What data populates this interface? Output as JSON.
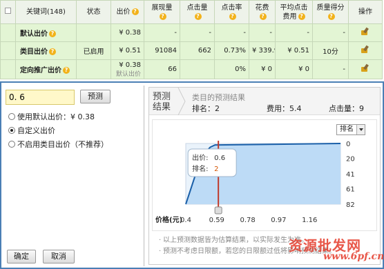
{
  "table": {
    "headers": {
      "keyword": "关键词(148)",
      "status": "状态",
      "bid": "出价",
      "impressions": "展现量",
      "clicks": "点击量",
      "ctr": "点击率",
      "cost": "花费",
      "avg_cpc_1": "平均点击",
      "avg_cpc_2": "费用",
      "quality": "质量得分",
      "actions": "操作"
    },
    "rows": [
      {
        "keyword": "默认出价",
        "status": "",
        "bid": "¥ 0.38",
        "bid_sub": "",
        "impressions": "-",
        "clicks": "-",
        "ctr": "-",
        "cost": "-",
        "cpc": "-",
        "quality": "-"
      },
      {
        "keyword": "类目出价",
        "status": "已启用",
        "bid": "¥ 0.51",
        "bid_sub": "",
        "impressions": "91084",
        "clicks": "662",
        "ctr": "0.73%",
        "cost": "¥ 339.9",
        "cpc": "¥ 0.51",
        "quality": "10分"
      },
      {
        "keyword": "定向推广出价",
        "status": "",
        "bid": "¥ 0.38",
        "bid_sub": "默认出价",
        "impressions": "66",
        "clicks": "",
        "ctr": "0%",
        "cost": "¥ 0",
        "cpc": "¥ 0",
        "quality": "-"
      }
    ]
  },
  "bid_panel": {
    "input_value": "0. 6",
    "predict_label": "预测",
    "options": [
      {
        "label": "使用默认出价：¥ 0.38",
        "selected": false
      },
      {
        "label": "自定义出价",
        "selected": true
      },
      {
        "label": "不启用类目出价（不推荐）",
        "selected": false
      }
    ],
    "confirm_label": "确定",
    "cancel_label": "取消"
  },
  "result": {
    "tag_line1": "预测",
    "tag_line2": "结果",
    "title": "类目的预测结果",
    "rank": "排名：2",
    "cost": "费用：5.4",
    "clicks": "点击量：9",
    "dropdown_value": "排名",
    "tooltip_bid_label": "出价:",
    "tooltip_bid_value": "0.6",
    "tooltip_rank_label": "排名:",
    "tooltip_rank_value": "2",
    "notes": [
      "以上预测数据皆为估算结果，以实际发生为准。",
      "预测不考虑日限额，若您的日限额过低将影响预测结果。"
    ]
  },
  "chart_data": {
    "type": "line",
    "xlabel": "价格(元)",
    "ylabel": "",
    "x_ticks": [
      "0.4",
      "0.59",
      "0.78",
      "0.97",
      "1.16"
    ],
    "y_ticks": [
      "0",
      "20",
      "41",
      "61",
      "82"
    ],
    "xlim": [
      0.4,
      1.35
    ],
    "ylim": [
      82,
      0
    ],
    "series": [
      {
        "x": [
          0.4,
          0.43,
          0.46,
          0.49,
          0.52,
          0.55,
          0.58,
          0.6,
          1.35
        ],
        "y": [
          82,
          62,
          42,
          25,
          12,
          5,
          2,
          2,
          0
        ]
      }
    ],
    "marker_x": 0.6,
    "colors": {
      "line": "#1a5fa8",
      "fill": "#b8d8f5",
      "marker": "#c0392b"
    }
  },
  "watermark": {
    "line1": "资源批发网",
    "line2": "www.6pf.cn"
  }
}
